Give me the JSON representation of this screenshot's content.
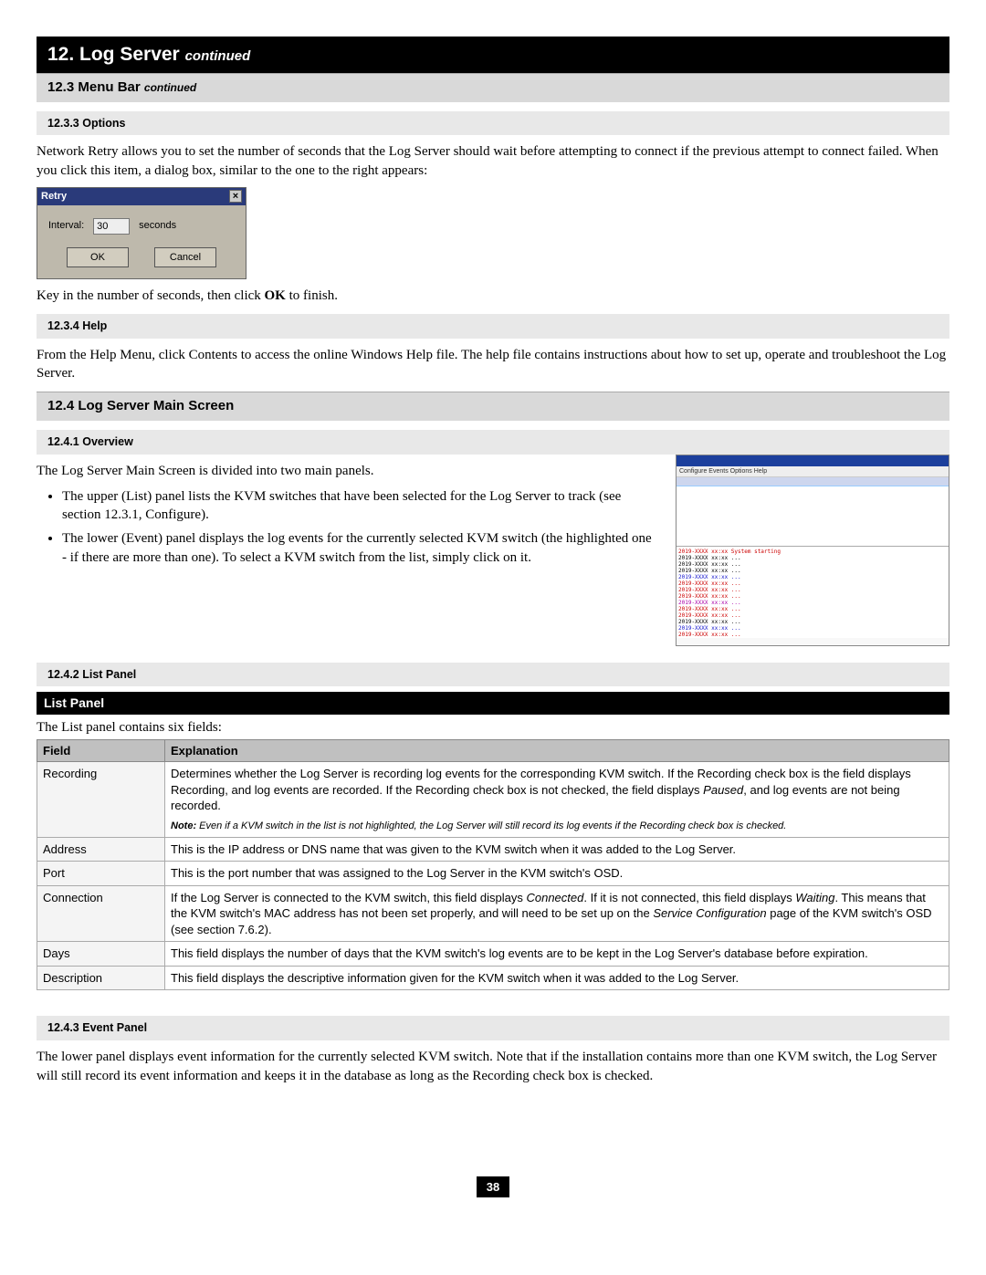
{
  "header": {
    "num": "12. Log Server",
    "cont": "continued"
  },
  "sec123": {
    "title": "12.3 Menu Bar",
    "cont": "continued"
  },
  "sec1233": {
    "title": "12.3.3 Options"
  },
  "p_options": "Network Retry allows you to set the number of seconds that the Log Server should wait before attempting to connect if the previous attempt to connect failed. When you click this item, a dialog box, similar to the one to the right appears:",
  "retry": {
    "title": "Retry",
    "interval_label": "Interval:",
    "interval_value": "30",
    "unit": "seconds",
    "ok": "OK",
    "cancel": "Cancel"
  },
  "p_keyin_pre": "Key in the number of seconds, then click ",
  "p_keyin_bold": "OK",
  "p_keyin_post": " to finish.",
  "sec1234": {
    "title": "12.3.4 Help"
  },
  "p_help": "From the Help Menu, click Contents to access the online Windows Help file. The help file contains instructions about how to set up, operate and troubleshoot the Log Server.",
  "sec124": {
    "title": "12.4 Log Server Main Screen"
  },
  "sec1241": {
    "title": "12.4.1 Overview"
  },
  "p_overview": "The Log Server Main Screen is divided into two main panels.",
  "bullets": {
    "b1_pre": "The upper (List) panel lists the KVM switches that have been selected for the Log Server to track (see section 12.3.1, ",
    "b1_ital": "Configure",
    "b1_post": ").",
    "b2": "The lower (Event) panel displays the log events for the currently selected KVM switch (the highlighted one - if there are more than one). To select a KVM switch from the list, simply click on it."
  },
  "sec1242": {
    "title": "12.4.2 List Panel"
  },
  "listpanel_heading": "List Panel",
  "p_listpanel": "The List panel contains six fields:",
  "table": {
    "h1": "Field",
    "h2": "Explanation",
    "rows": [
      {
        "f": "Recording",
        "e_plain1": "Determines whether the Log Server is recording log events for the corresponding KVM switch. If the Recording check box is the field displays Recording, and log events are recorded. If the Recording check box is not checked, the field displays ",
        "e_ital1": "Paused",
        "e_plain2": ", and log events are not being recorded.",
        "note_b": "Note:",
        "note_rest": " Even if a KVM switch in the list is not highlighted, the Log Server will still record its log events if the Recording check box is checked."
      },
      {
        "f": "Address",
        "e": "This is the IP address or DNS name that was given to the KVM switch when it was added to the Log Server."
      },
      {
        "f": "Port",
        "e": "This is the port number that was assigned to the Log Server in the KVM switch's OSD."
      },
      {
        "f": "Connection",
        "e_p1": "If the Log Server is connected to the KVM switch, this field displays ",
        "e_i1": "Connected",
        "e_p2": ". If it is not connected, this field displays ",
        "e_i2": "Waiting",
        "e_p3": ". This means that the KVM switch's MAC address has not been set properly, and will need to be set up on the ",
        "e_i3": "Service Configuration",
        "e_p4": " page of the KVM switch's OSD (see section 7.6.2)."
      },
      {
        "f": "Days",
        "e": "This field displays the number of days that the KVM switch's log events are to be kept in the Log Server's database before expiration."
      },
      {
        "f": "Description",
        "e": "This field displays the descriptive information given for the KVM switch when it was added to the Log Server."
      }
    ]
  },
  "sec1243": {
    "title": "12.4.3 Event Panel"
  },
  "p_event": "The lower panel displays event information for the currently selected KVM switch. Note that if the installation contains more than one KVM switch, the Log Server will still record its event information and keeps it in the database as long as the Recording check box is checked.",
  "screenshot_menu": "Configure  Events  Options  Help",
  "page": "38"
}
